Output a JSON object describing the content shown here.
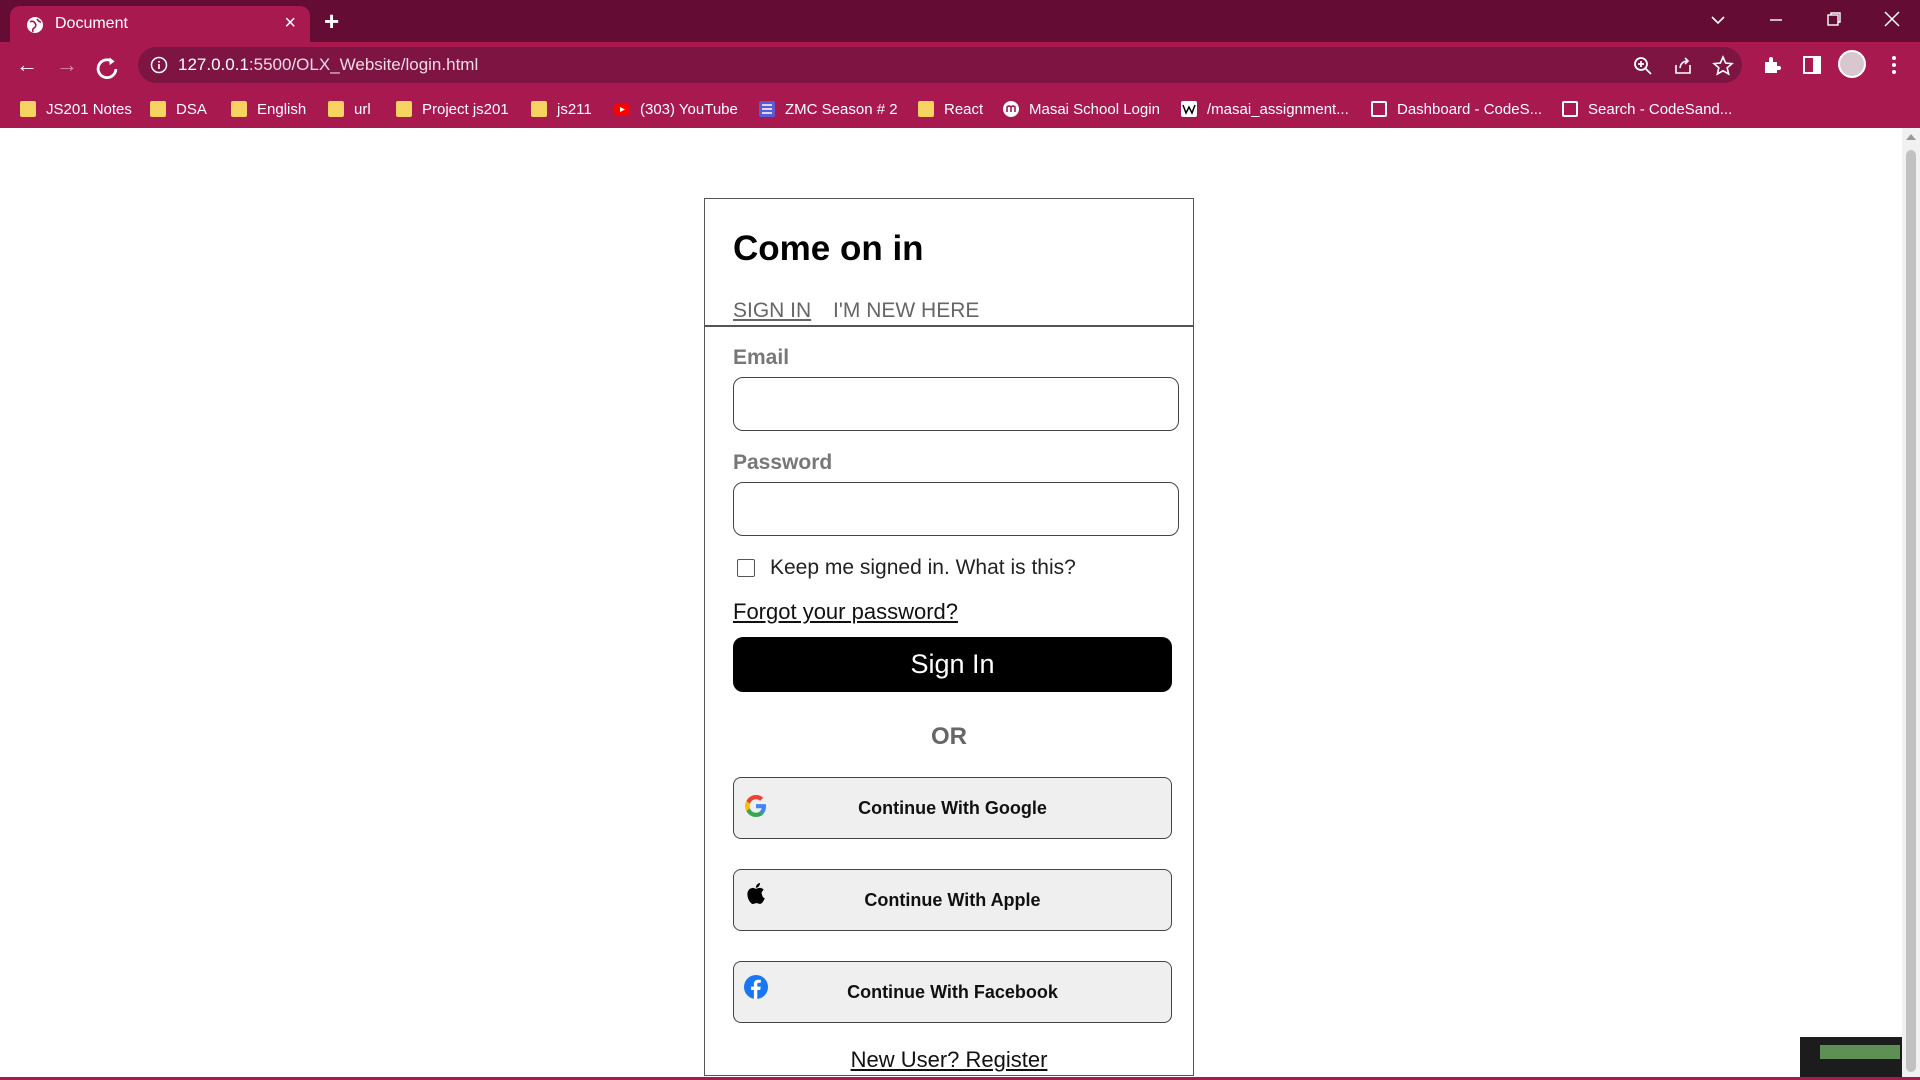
{
  "browser": {
    "tab_title": "Document",
    "url_host": "127.0.0.1",
    "url_rest": ":5500/OLX_Website/login.html",
    "bookmarks": [
      {
        "label": "JS201 Notes",
        "icon": "folder-icon"
      },
      {
        "label": "DSA",
        "icon": "folder-icon"
      },
      {
        "label": "English",
        "icon": "folder-icon"
      },
      {
        "label": "url",
        "icon": "folder-icon"
      },
      {
        "label": "Project js201",
        "icon": "folder-icon"
      },
      {
        "label": "js211",
        "icon": "folder-icon"
      },
      {
        "label": "(303) YouTube",
        "icon": "youtube-icon"
      },
      {
        "label": "ZMC Season # 2",
        "icon": "list-icon"
      },
      {
        "label": "React",
        "icon": "folder-icon"
      },
      {
        "label": "Masai School Login",
        "icon": "masai-icon"
      },
      {
        "label": "/masai_assignment...",
        "icon": "wiki-icon"
      },
      {
        "label": "Dashboard - CodeS...",
        "icon": "page-icon"
      },
      {
        "label": "Search - CodeSand...",
        "icon": "page-icon"
      }
    ]
  },
  "login": {
    "title": "Come on in",
    "tab_signin": "SIGN IN",
    "tab_new": "I'M NEW HERE",
    "email_label": "Email",
    "email_value": "",
    "password_label": "Password",
    "password_value": "",
    "keep_signed_in": "Keep me signed in. What is this?",
    "forgot_password": "Forgot your password?",
    "signin_button": "Sign In",
    "or_text": "OR",
    "google_button": "Continue With Google",
    "apple_button": "Continue With Apple",
    "facebook_button": "Continue With Facebook",
    "register_link": "New User? Register"
  },
  "colors": {
    "chrome_dark": "#650c34",
    "chrome_accent": "#a8194f",
    "signin_bg": "#000000"
  }
}
